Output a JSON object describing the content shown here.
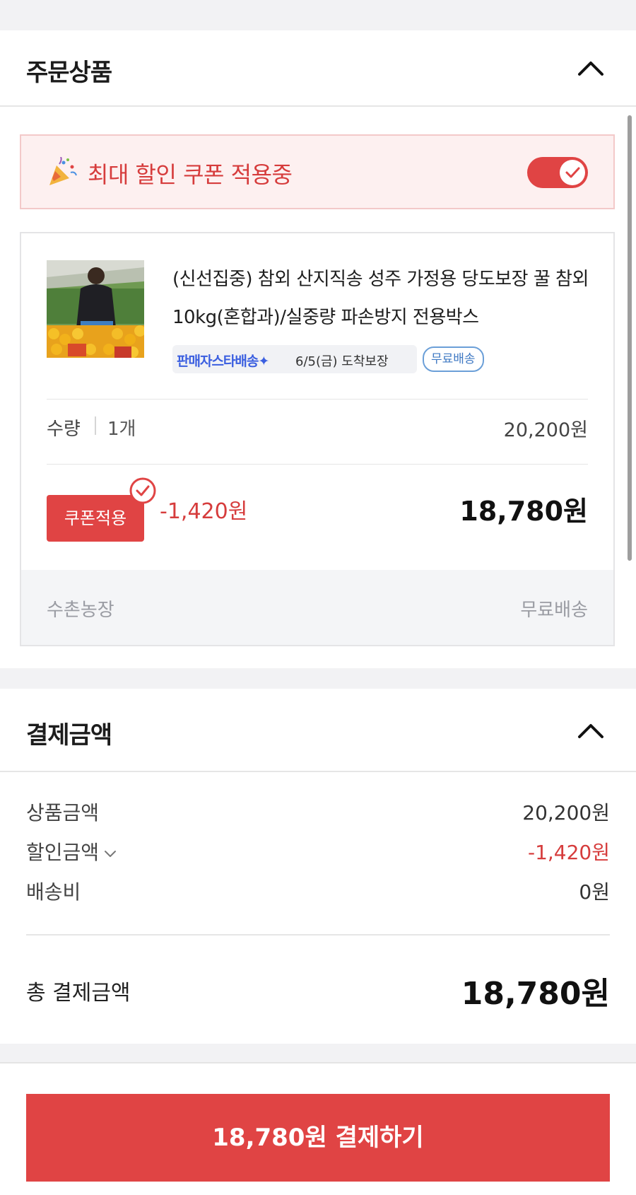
{
  "order_section": {
    "title": "주문상품",
    "collapse_icon": "chevron-up-icon"
  },
  "coupon_banner": {
    "icon": "party-popper-icon",
    "text": "최대 할인 쿠폰 적용중",
    "toggle_on": true
  },
  "product": {
    "name": "(신선집중) 참외 산지직송 성주 가정용 당도보장 꿀 참외 10kg(혼합과)/실중량 파손방지 전용박스",
    "star_delivery_label": "판매자스타배송✦",
    "arrival_text": "6/5(금) 도착보장",
    "free_shipping_chip": "무료배송",
    "quantity_label": "수량",
    "quantity_value": "1개",
    "line_price": "20,200원",
    "coupon_button": "쿠폰적용",
    "discount": "-1,420원",
    "final_price": "18,780원",
    "seller": "수촌농장",
    "shipping": "무료배송"
  },
  "payment_section": {
    "title": "결제금액",
    "collapse_icon": "chevron-up-icon",
    "rows": [
      {
        "label": "상품금액",
        "value": "20,200원"
      },
      {
        "label": "할인금액",
        "value": "-1,420원"
      },
      {
        "label": "배송비",
        "value": "0원"
      }
    ],
    "total_label": "총 결제금액",
    "total_value": "18,780원"
  },
  "bottom_bar": {
    "pay_button": "18,780원 결제하기"
  },
  "colors": {
    "accent": "#e04444",
    "discount_red": "#d63c3c",
    "free_ship_blue": "#3e78c3"
  }
}
